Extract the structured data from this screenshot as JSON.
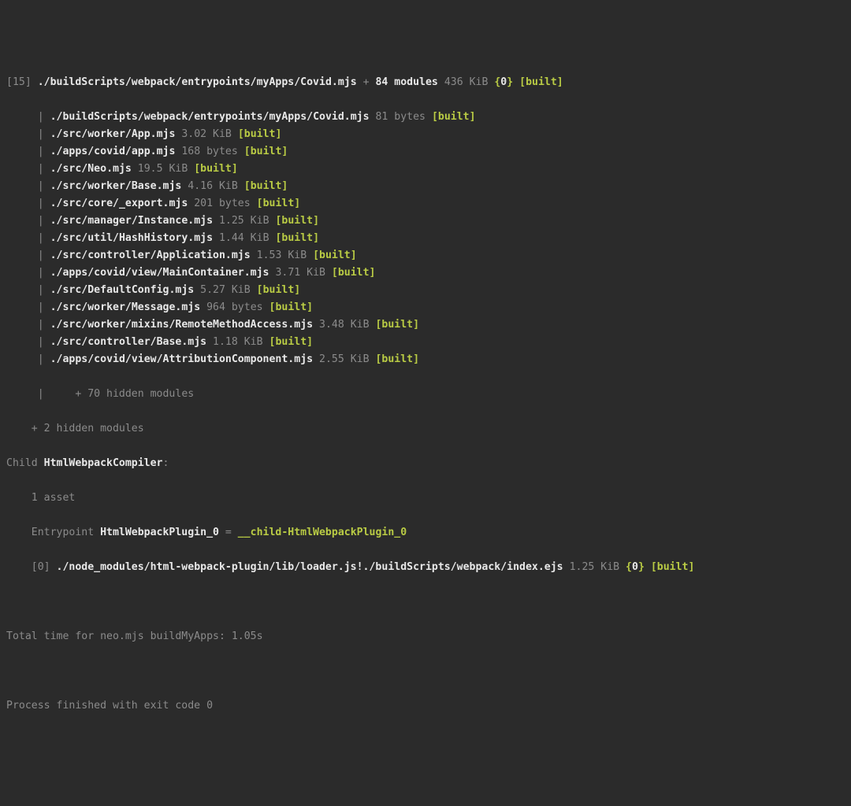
{
  "entry": {
    "index": "[15]",
    "path": "./buildScripts/webpack/entrypoints/myApps/Covid.mjs",
    "plus": " + ",
    "extra": "84 modules",
    "size": " 436 KiB ",
    "chunk_open": "{",
    "chunk_id": "0",
    "chunk_close": "}",
    "built": "[built]"
  },
  "modules": [
    {
      "path": "./buildScripts/webpack/entrypoints/myApps/Covid.mjs",
      "size": " 81 bytes ",
      "built": "[built]"
    },
    {
      "path": "./src/worker/App.mjs",
      "size": " 3.02 KiB ",
      "built": "[built]"
    },
    {
      "path": "./apps/covid/app.mjs",
      "size": " 168 bytes ",
      "built": "[built]"
    },
    {
      "path": "./src/Neo.mjs",
      "size": " 19.5 KiB ",
      "built": "[built]"
    },
    {
      "path": "./src/worker/Base.mjs",
      "size": " 4.16 KiB ",
      "built": "[built]"
    },
    {
      "path": "./src/core/_export.mjs",
      "size": " 201 bytes ",
      "built": "[built]"
    },
    {
      "path": "./src/manager/Instance.mjs",
      "size": " 1.25 KiB ",
      "built": "[built]"
    },
    {
      "path": "./src/util/HashHistory.mjs",
      "size": " 1.44 KiB ",
      "built": "[built]"
    },
    {
      "path": "./src/controller/Application.mjs",
      "size": " 1.53 KiB ",
      "built": "[built]"
    },
    {
      "path": "./apps/covid/view/MainContainer.mjs",
      "size": " 3.71 KiB ",
      "built": "[built]"
    },
    {
      "path": "./src/DefaultConfig.mjs",
      "size": " 5.27 KiB ",
      "built": "[built]"
    },
    {
      "path": "./src/worker/Message.mjs",
      "size": " 964 bytes ",
      "built": "[built]"
    },
    {
      "path": "./src/worker/mixins/RemoteMethodAccess.mjs",
      "size": " 3.48 KiB ",
      "built": "[built]"
    },
    {
      "path": "./src/controller/Base.mjs",
      "size": " 1.18 KiB ",
      "built": "[built]"
    },
    {
      "path": "./apps/covid/view/AttributionComponent.mjs",
      "size": " 2.55 KiB ",
      "built": "[built]"
    }
  ],
  "pipe": "|",
  "space_after_index": " ",
  "mod_hidden_line": "|     + 70 hidden modules",
  "plus_hidden": "    + 2 hidden modules",
  "child_prefix": "Child ",
  "child_name": "HtmlWebpackCompiler",
  "child_colon": ":",
  "asset_line": "    1 asset",
  "entrypoint_prefix": "    Entrypoint ",
  "entrypoint_name": "HtmlWebpackPlugin_0",
  "equals": " = ",
  "entrypoint_out": "__child-HtmlWebpackPlugin_0",
  "child_mod": {
    "index": "    [0]",
    "path": " ./node_modules/html-webpack-plugin/lib/loader.js!./buildScripts/webpack/index.ejs",
    "size": " 1.25 KiB ",
    "chunk_open": "{",
    "chunk_id": "0",
    "chunk_close": "}",
    "built": "[built]"
  },
  "blank": " ",
  "timing": "Total time for neo.mjs buildMyApps: 1.05s",
  "finished": "Process finished with exit code 0"
}
